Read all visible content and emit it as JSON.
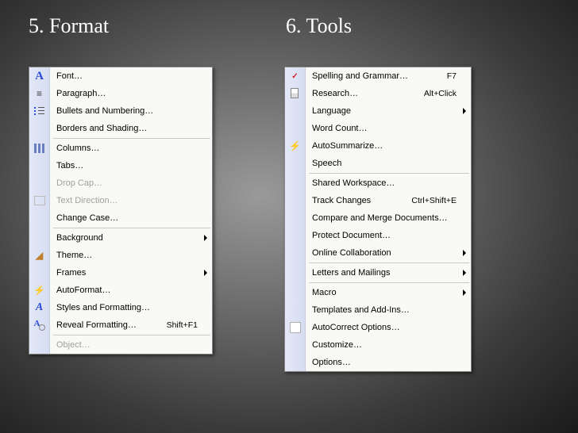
{
  "titles": {
    "format": "5. Format",
    "tools": "6. Tools"
  },
  "format_menu": {
    "items": [
      {
        "label": "Font…",
        "icon": "font-icon",
        "shortcut": "",
        "submenu": false,
        "disabled": false
      },
      {
        "label": "Paragraph…",
        "icon": "paragraph-icon",
        "shortcut": "",
        "submenu": false,
        "disabled": false
      },
      {
        "label": "Bullets and Numbering…",
        "icon": "bullets-icon",
        "shortcut": "",
        "submenu": false,
        "disabled": false
      },
      {
        "label": "Borders and Shading…",
        "icon": "",
        "shortcut": "",
        "submenu": false,
        "disabled": false
      },
      {
        "sep": true
      },
      {
        "label": "Columns…",
        "icon": "columns-icon",
        "shortcut": "",
        "submenu": false,
        "disabled": false
      },
      {
        "label": "Tabs…",
        "icon": "",
        "shortcut": "",
        "submenu": false,
        "disabled": false
      },
      {
        "label": "Drop Cap…",
        "icon": "",
        "shortcut": "",
        "submenu": false,
        "disabled": true
      },
      {
        "label": "Text Direction…",
        "icon": "textdir-icon",
        "shortcut": "",
        "submenu": false,
        "disabled": true
      },
      {
        "label": "Change Case…",
        "icon": "",
        "shortcut": "",
        "submenu": false,
        "disabled": false
      },
      {
        "sep": true
      },
      {
        "label": "Background",
        "icon": "",
        "shortcut": "",
        "submenu": true,
        "disabled": false
      },
      {
        "label": "Theme…",
        "icon": "paint-icon",
        "shortcut": "",
        "submenu": false,
        "disabled": false
      },
      {
        "label": "Frames",
        "icon": "",
        "shortcut": "",
        "submenu": true,
        "disabled": false
      },
      {
        "label": "AutoFormat…",
        "icon": "autoformat-icon",
        "shortcut": "",
        "submenu": false,
        "disabled": false
      },
      {
        "label": "Styles and Formatting…",
        "icon": "styles-icon",
        "shortcut": "",
        "submenu": false,
        "disabled": false
      },
      {
        "label": "Reveal Formatting…",
        "icon": "reveal-icon",
        "shortcut": "Shift+F1",
        "submenu": false,
        "disabled": false
      },
      {
        "sep": true
      },
      {
        "label": "Object…",
        "icon": "",
        "shortcut": "",
        "submenu": false,
        "disabled": true
      }
    ]
  },
  "tools_menu": {
    "items": [
      {
        "label": "Spelling and Grammar…",
        "icon": "spell-icon",
        "shortcut": "F7",
        "submenu": false,
        "disabled": false
      },
      {
        "label": "Research…",
        "icon": "research-icon",
        "shortcut": "Alt+Click",
        "submenu": false,
        "disabled": false
      },
      {
        "label": "Language",
        "icon": "",
        "shortcut": "",
        "submenu": true,
        "disabled": false
      },
      {
        "label": "Word Count…",
        "icon": "wordcount-icon",
        "shortcut": "",
        "submenu": false,
        "disabled": false
      },
      {
        "label": "AutoSummarize…",
        "icon": "summarize-icon",
        "shortcut": "",
        "submenu": false,
        "disabled": false
      },
      {
        "label": "Speech",
        "icon": "",
        "shortcut": "",
        "submenu": false,
        "disabled": false
      },
      {
        "sep": true
      },
      {
        "label": "Shared Workspace…",
        "icon": "",
        "shortcut": "",
        "submenu": false,
        "disabled": false
      },
      {
        "label": "Track Changes",
        "icon": "",
        "shortcut": "Ctrl+Shift+E",
        "submenu": false,
        "disabled": false
      },
      {
        "label": "Compare and Merge Documents…",
        "icon": "",
        "shortcut": "",
        "submenu": false,
        "disabled": false
      },
      {
        "label": "Protect Document…",
        "icon": "",
        "shortcut": "",
        "submenu": false,
        "disabled": false
      },
      {
        "label": "Online Collaboration",
        "icon": "",
        "shortcut": "",
        "submenu": true,
        "disabled": false
      },
      {
        "sep": true
      },
      {
        "label": "Letters and Mailings",
        "icon": "",
        "shortcut": "",
        "submenu": true,
        "disabled": false
      },
      {
        "sep": true
      },
      {
        "label": "Macro",
        "icon": "",
        "shortcut": "",
        "submenu": true,
        "disabled": false
      },
      {
        "label": "Templates and Add-Ins…",
        "icon": "",
        "shortcut": "",
        "submenu": false,
        "disabled": false
      },
      {
        "label": "AutoCorrect Options…",
        "icon": "autocorrect-icon",
        "shortcut": "",
        "submenu": false,
        "disabled": false
      },
      {
        "label": "Customize…",
        "icon": "",
        "shortcut": "",
        "submenu": false,
        "disabled": false
      },
      {
        "label": "Options…",
        "icon": "",
        "shortcut": "",
        "submenu": false,
        "disabled": false
      }
    ]
  },
  "icon_glyphs": {
    "font-icon": "A",
    "paragraph-icon": "≡",
    "styles-icon": "A",
    "spell-icon": "✓",
    "paint-icon": "◢",
    "autoformat-icon": "⚡",
    "summarize-icon": "⚡"
  }
}
